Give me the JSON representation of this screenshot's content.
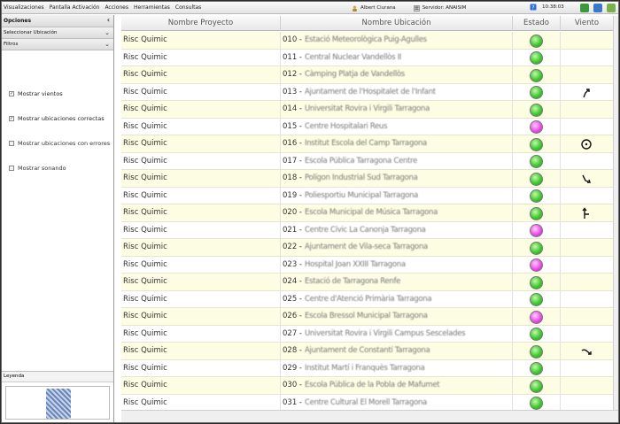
{
  "menubar": {
    "items": [
      "Visualizaciones",
      "Pantalla Activación",
      "Acciones",
      "Herramientas",
      "Consultas"
    ],
    "user": "Albert Ciurana",
    "server": "Servidor: ANAISIM",
    "time": "10:38:03"
  },
  "sidebar": {
    "options_title": "Opciones",
    "select_location": "Seleccionar Ubicación",
    "filters_title": "Filtros",
    "filters": [
      {
        "label": "Mostrar vientos",
        "checked": true
      },
      {
        "label": "Mostrar ubicaciones correctas",
        "checked": true
      },
      {
        "label": "Mostrar ubicaciones con errores",
        "checked": false
      },
      {
        "label": "Mostrar sonando",
        "checked": false
      }
    ],
    "legend_title": "Leyenda"
  },
  "table": {
    "headers": {
      "project": "Nombre Proyecto",
      "location": "Nombre Ubicación",
      "status": "Estado",
      "wind": "Viento"
    },
    "rows": [
      {
        "project": "Risc Quimic",
        "code": "010 -",
        "location": "Estació Meteorològica Puig-Agulles",
        "status": "green",
        "wind": ""
      },
      {
        "project": "Risc Quimic",
        "code": "011 -",
        "location": "Central Nuclear Vandellòs II",
        "status": "green",
        "wind": ""
      },
      {
        "project": "Risc Quimic",
        "code": "012 -",
        "location": "Càmping Platja de Vandellòs",
        "status": "green",
        "wind": ""
      },
      {
        "project": "Risc Quimic",
        "code": "013 -",
        "location": "Ajuntament de l'Hospitalet de l'Infant",
        "status": "green",
        "wind": "arrow-ne"
      },
      {
        "project": "Risc Quimic",
        "code": "014 -",
        "location": "Universitat Rovira i Virgili Tarragona",
        "status": "green",
        "wind": ""
      },
      {
        "project": "Risc Quimic",
        "code": "015 -",
        "location": "Centre Hospitalari Reus",
        "status": "pink",
        "wind": ""
      },
      {
        "project": "Risc Quimic",
        "code": "016 -",
        "location": "Institut Escola del Camp Tarragona",
        "status": "green",
        "wind": "calm"
      },
      {
        "project": "Risc Quimic",
        "code": "017 -",
        "location": "Escola Pública Tarragona Centre",
        "status": "green",
        "wind": ""
      },
      {
        "project": "Risc Quimic",
        "code": "018 -",
        "location": "Polígon Industrial Sud Tarragona",
        "status": "green",
        "wind": "arrow-se"
      },
      {
        "project": "Risc Quimic",
        "code": "019 -",
        "location": "Poliesportiu Municipal Tarragona",
        "status": "green",
        "wind": ""
      },
      {
        "project": "Risc Quimic",
        "code": "020 -",
        "location": "Escola Municipal de Música Tarragona",
        "status": "green",
        "wind": "arrow-n"
      },
      {
        "project": "Risc Quimic",
        "code": "021 -",
        "location": "Centre Cívic La Canonja Tarragona",
        "status": "pink",
        "wind": ""
      },
      {
        "project": "Risc Quimic",
        "code": "022 -",
        "location": "Ajuntament de Vila-seca Tarragona",
        "status": "green",
        "wind": ""
      },
      {
        "project": "Risc Quimic",
        "code": "023 -",
        "location": "Hospital Joan XXIII Tarragona",
        "status": "pink",
        "wind": ""
      },
      {
        "project": "Risc Quimic",
        "code": "024 -",
        "location": "Estació de Tarragona Renfe",
        "status": "green",
        "wind": ""
      },
      {
        "project": "Risc Quimic",
        "code": "025 -",
        "location": "Centre d'Atenció Primària Tarragona",
        "status": "green",
        "wind": ""
      },
      {
        "project": "Risc Quimic",
        "code": "026 -",
        "location": "Escola Bressol Municipal Tarragona",
        "status": "pink",
        "wind": ""
      },
      {
        "project": "Risc Quimic",
        "code": "027 -",
        "location": "Universitat Rovira i Virgili Campus Sescelades",
        "status": "green",
        "wind": ""
      },
      {
        "project": "Risc Quimic",
        "code": "028 -",
        "location": "Ajuntament de Constantí Tarragona",
        "status": "green",
        "wind": "arrow-e"
      },
      {
        "project": "Risc Quimic",
        "code": "029 -",
        "location": "Institut Martí i Franquès Tarragona",
        "status": "green",
        "wind": ""
      },
      {
        "project": "Risc Quimic",
        "code": "030 -",
        "location": "Escola Pública de la Pobla de Mafumet",
        "status": "green",
        "wind": ""
      },
      {
        "project": "Risc Quimic",
        "code": "031 -",
        "location": "Centre Cultural El Morell Tarragona",
        "status": "green",
        "wind": ""
      }
    ]
  },
  "colors": {
    "accent_row": "#fdfde3",
    "ok": "#3ecb2e",
    "alarm": "#ec4fe6"
  }
}
